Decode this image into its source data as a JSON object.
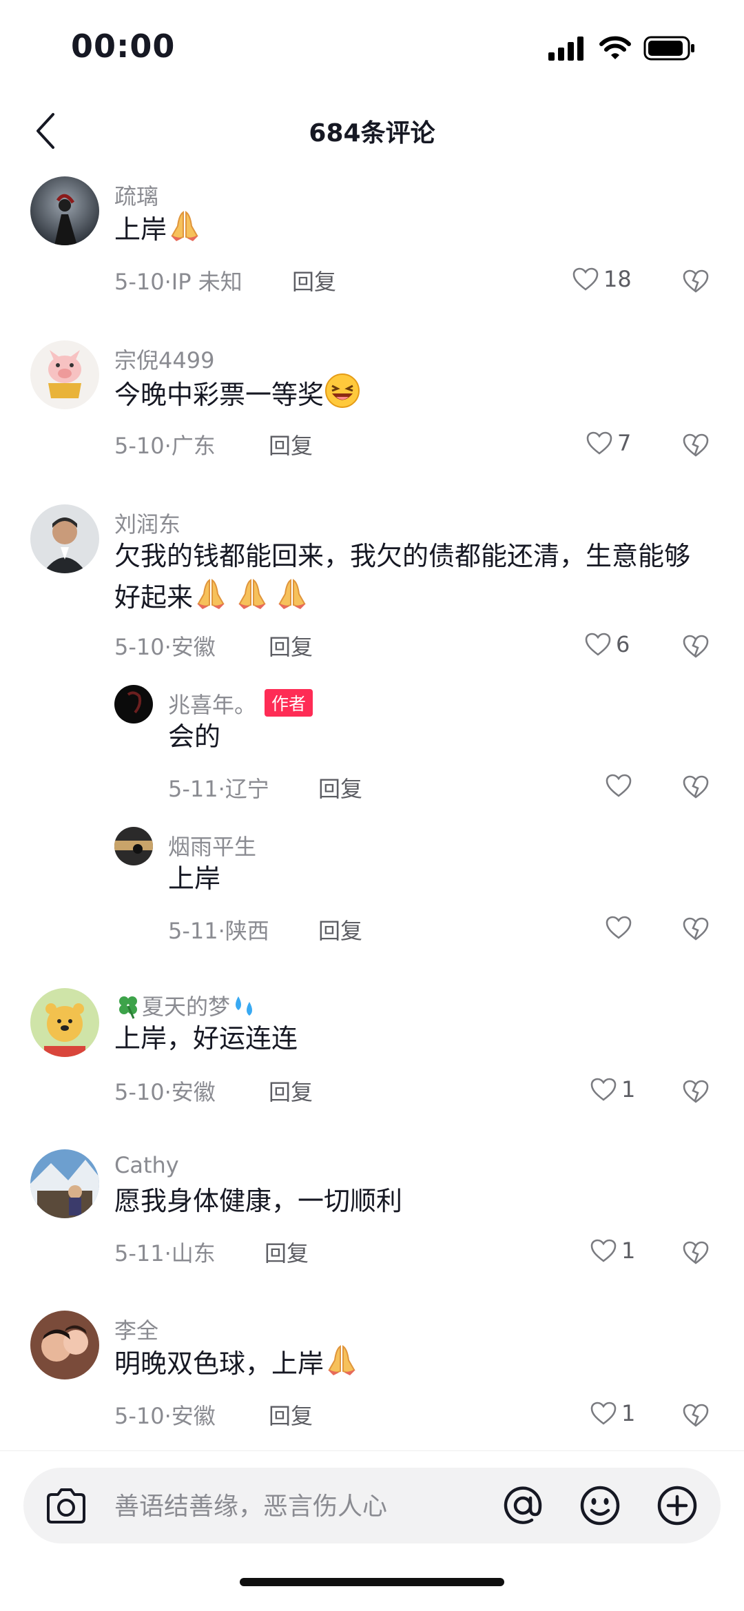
{
  "status_bar": {
    "time": "00:00"
  },
  "header": {
    "title": "684条评论"
  },
  "comments": [
    {
      "user": "疏璃",
      "text": "上岸",
      "emoji": "pray",
      "date": "5-10",
      "location": "IP 未知",
      "reply_label": "回复",
      "likes": "18"
    },
    {
      "user": "宗倪4499",
      "text": "今晚中彩票一等奖",
      "emoji": "laugh",
      "date": "5-10",
      "location": "广东",
      "reply_label": "回复",
      "likes": "7"
    },
    {
      "user": "刘润东",
      "text": "欠我的钱都能回来，我欠的债都能还清，生意能够好起来",
      "emoji": "pray-x3",
      "date": "5-10",
      "location": "安徽",
      "reply_label": "回复",
      "likes": "6",
      "replies": [
        {
          "user": "兆喜年。",
          "badge": "作者",
          "text": "会的",
          "date": "5-11",
          "location": "辽宁",
          "reply_label": "回复",
          "likes": ""
        },
        {
          "user": "烟雨平生",
          "text": "上岸",
          "date": "5-11",
          "location": "陕西",
          "reply_label": "回复",
          "likes": ""
        }
      ]
    },
    {
      "user": "夏天的梦",
      "user_prefix_emoji": "clover",
      "user_suffix_emoji": "sweat-drops",
      "text": "上岸，好运连连",
      "date": "5-10",
      "location": "安徽",
      "reply_label": "回复",
      "likes": "1"
    },
    {
      "user": "Cathy",
      "text": "愿我身体健康，一切顺利",
      "date": "5-11",
      "location": "山东",
      "reply_label": "回复",
      "likes": "1"
    },
    {
      "user": "李全",
      "text": "明晚双色球，上岸",
      "emoji": "pray",
      "date": "5-10",
      "location": "安徽",
      "reply_label": "回复",
      "likes": "1"
    }
  ],
  "meta_separator": "·",
  "input": {
    "placeholder": "善语结善缘，恶言伤人心"
  },
  "icons": [
    "back-icon",
    "signal-icon",
    "wifi-icon",
    "battery-icon",
    "heart-icon",
    "dislike-icon",
    "camera-icon",
    "at-icon",
    "emoji-icon",
    "plus-icon"
  ],
  "colors": {
    "accent": "#fe2c55",
    "text": "#161823",
    "muted": "#8a8b91"
  }
}
